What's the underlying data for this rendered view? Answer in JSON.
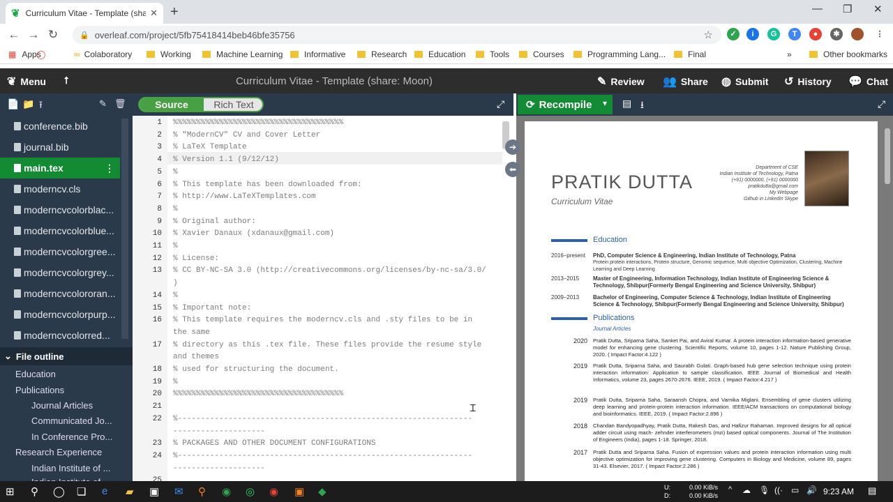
{
  "browser": {
    "tab_title": "Curriculum Vitae - Template (share: Moon)",
    "url": "overleaf.com/project/5fb75418414beb46bfe35756",
    "bookmarks": [
      "Apps",
      "Colaboratory",
      "Working",
      "Machine Learning",
      "Informative",
      "Research",
      "Education",
      "Tools",
      "Courses",
      "Programming Lang...",
      "Final"
    ],
    "other_bookmarks": "Other bookmarks",
    "bookmarks_overflow": "»"
  },
  "toolbar": {
    "menu": "Menu",
    "title": "Curriculum Vitae - Template (share: Moon)",
    "review": "Review",
    "share": "Share",
    "submit": "Submit",
    "history": "History",
    "chat": "Chat"
  },
  "files": [
    "conference.bib",
    "journal.bib",
    "main.tex",
    "moderncv.cls",
    "moderncvcolorblac...",
    "moderncvcolorblue...",
    "moderncvcolorgree...",
    "moderncvcolorgrey...",
    "moderncvcolororan...",
    "moderncvcolorpurp...",
    "moderncvcolorred..."
  ],
  "outline": {
    "header": "File outline",
    "items": [
      "Education",
      "Publications",
      "Journal Articles",
      "Communicated Jo...",
      "In Conference Pro...",
      "Research Experience",
      "Indian Institute of ...",
      "Indian Institute of ..."
    ]
  },
  "editor": {
    "source": "Source",
    "rich": "Rich Text",
    "lines": [
      {
        "n": "1",
        "t": "%%%%%%%%%%%%%%%%%%%%%%%%%%%%%%%%%%%%%"
      },
      {
        "n": "2",
        "t": "% \"ModernCV\" CV and Cover Letter"
      },
      {
        "n": "3",
        "t": "% LaTeX Template"
      },
      {
        "n": "4",
        "t": "% Version 1.1 (9/12/12)"
      },
      {
        "n": "5",
        "t": "%"
      },
      {
        "n": "6",
        "t": "% This template has been downloaded from:"
      },
      {
        "n": "7",
        "t": "% http://www.LaTeXTemplates.com"
      },
      {
        "n": "8",
        "t": "%"
      },
      {
        "n": "9",
        "t": "% Original author:"
      },
      {
        "n": "10",
        "t": "% Xavier Danaux (xdanaux@gmail.com)"
      },
      {
        "n": "11",
        "t": "%"
      },
      {
        "n": "12",
        "t": "% License:"
      },
      {
        "n": "13",
        "t": "% CC BY-NC-SA 3.0 (http://creativecommons.org/licenses/by-nc-sa/3.0/"
      },
      {
        "n": "",
        "t": ")"
      },
      {
        "n": "14",
        "t": "%"
      },
      {
        "n": "15",
        "t": "% Important note:"
      },
      {
        "n": "16",
        "t": "% This template requires the moderncv.cls and .sty files to be in"
      },
      {
        "n": "",
        "t": "the same"
      },
      {
        "n": "17",
        "t": "% directory as this .tex file. These files provide the resume style"
      },
      {
        "n": "",
        "t": "and themes"
      },
      {
        "n": "18",
        "t": "% used for structuring the document."
      },
      {
        "n": "19",
        "t": "%"
      },
      {
        "n": "20",
        "t": "%%%%%%%%%%%%%%%%%%%%%%%%%%%%%%%%%%%%%"
      },
      {
        "n": "21",
        "t": ""
      },
      {
        "n": "22",
        "t": "%----------------------------------------------------------------"
      },
      {
        "n": "",
        "t": "--------------------"
      },
      {
        "n": "23",
        "t": "%   PACKAGES AND OTHER DOCUMENT CONFIGURATIONS"
      },
      {
        "n": "24",
        "t": "%----------------------------------------------------------------"
      },
      {
        "n": "",
        "t": "--------------------"
      },
      {
        "n": "25",
        "t": ""
      }
    ]
  },
  "pdf": {
    "recompile": "Recompile",
    "first": "PRATIK",
    "last": "DUTTA",
    "subtitle": "Curriculum Vitae",
    "contact": [
      "Department of CSE",
      "Indian Institute of Technology, Patna",
      "(+91) 0000000, (+91) 0000000",
      "pratikdutta@gmail.com",
      "My Webpage",
      "Github   in LinkedIn   Skype"
    ],
    "education_h": "Education",
    "education": [
      {
        "y": "2016–present",
        "t": "PhD, Computer Science & Engineering, Indian Institute of Technology, Patna",
        "d": "Protein protein interactions, Protein structure, Genomic sequence, Multi objective Optimization, Clustering, Machine Learning and Deep Learning"
      },
      {
        "y": "2013–2015",
        "t": "Master of Engineering, Information Technology, Indian Institute of Engineering Science & Technology, Shibpur(Formerly Bengal Engineering and Science University, Shibpur)",
        "d": ""
      },
      {
        "y": "2009–2013",
        "t": "Bachelor of Engineering, Computer Science & Technology, Indian Institute of Engineering Science & Technology, Shibpur(Formerly Bengal Engineering and Science University, Shibpur)",
        "d": ""
      }
    ],
    "pub_h": "Publications",
    "pub_sub": "Journal Articles",
    "pubs": [
      {
        "y": "2020",
        "t": "Pratik Dutta, Sriparna Saha, Sanket Pai, and Aviral Kumar. A protein interaction information-based generative model for enhancing gene clustering. Scientific Reports, volume 10, pages 1-12. Nature Publishing Group, 2020. ( Impact Factor:4.122 )"
      },
      {
        "y": "2019",
        "t": "Pratik Dutta, Sriparna Saha, and Saurabh Gulati. Graph-based hub gene selection technique using protein interaction information: Application to sample classification. IEEE Journal of Biomedical and Health Informatics, volume 23, pages 2670-2676. IEEE, 2019. ( Impact Factor:4.217 )"
      },
      {
        "y": "2019",
        "t": "Pratik Dutta, Sriparna Saha, Saraansh Chopra, and Varnika Miglani. Ensembling of gene clusters utilizing deep learning and protein-protein interaction information. IEEE/ACM transactions on computational biology and bioinformatics. IEEE, 2019. ( Impact Factor:2.896 )"
      },
      {
        "y": "2018",
        "t": "Chandan Bandyopadhyay, Pratik Dutta, Rakesh Das, and Hafizur Rahaman. Improved designs for all optical adder circuit using mach- zehnder interferometers (mzi) based optical components. Journal of The Institution of Engineers (India), pages 1-18. Springer, 2018."
      },
      {
        "y": "2017",
        "t": "Pratik Dutta and Sriparna Saha. Fusion of expression values and protein interaction information using multi objective optimization for improving gene clustering. Computers in Biology and Medicine, volume 89, pages 31-43. Elsevier, 2017. ( Impact Factor:2.286 )"
      }
    ]
  },
  "taskbar": {
    "time": "9:23 AM",
    "net_up": "0.00 KiB/s",
    "net_down": "0.00 KiB/s",
    "net_up_label": "U:",
    "net_down_label": "D:"
  }
}
